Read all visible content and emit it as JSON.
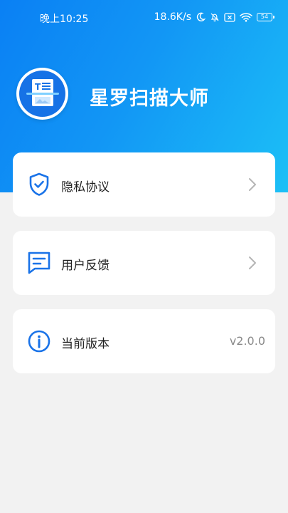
{
  "status": {
    "time": "晚上10:25",
    "speed": "18.6K/s",
    "battery": "54"
  },
  "app": {
    "name": "星罗扫描大师"
  },
  "menu": [
    {
      "label": "隐私协议",
      "icon": "shield-check-icon"
    },
    {
      "label": "用户反馈",
      "icon": "message-icon"
    },
    {
      "label": "当前版本",
      "icon": "info-icon",
      "value": "v2.0.0"
    }
  ],
  "colors": {
    "accent": "#1a73e8",
    "header_start": "#0a80f4",
    "header_end": "#1cc0f6",
    "background": "#f2f2f2"
  }
}
